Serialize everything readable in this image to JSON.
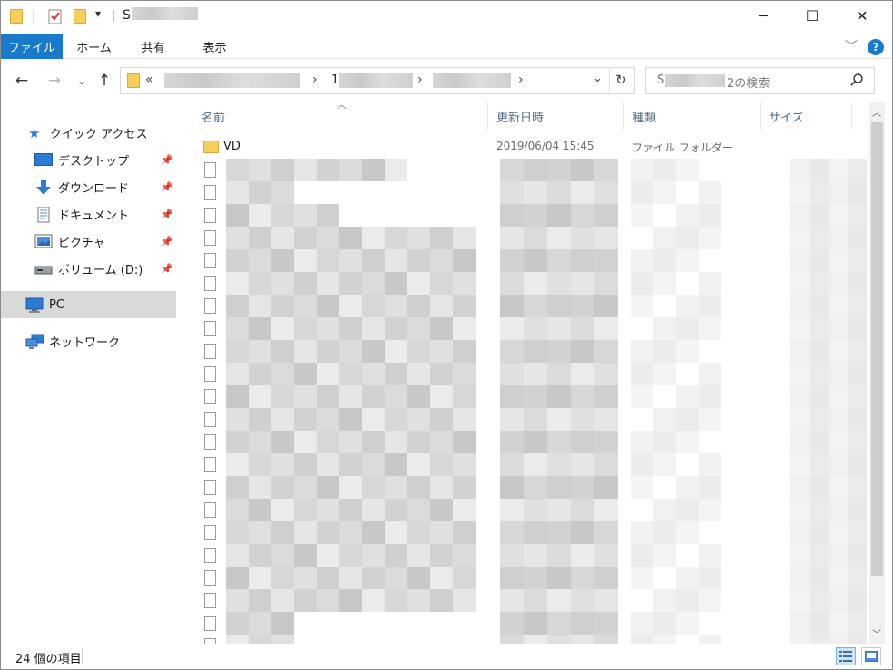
{
  "titlebar": {
    "title": "S",
    "minimize": "─",
    "maximize": "☐",
    "close": "✕"
  },
  "ribbon": {
    "tabs": [
      "ファイル",
      "ホーム",
      "共有",
      "表示"
    ],
    "expand_chevron": "﹀",
    "help": "?"
  },
  "nav": {
    "back": "←",
    "forward": "→",
    "recent": "⌄",
    "up": "↑"
  },
  "address": {
    "prefix": "«",
    "seg2": "1",
    "sep": "›",
    "dropdown": "⌄",
    "refresh": "↻"
  },
  "search": {
    "placeholder_prefix": "S",
    "placeholder_suffix": "2の検索",
    "icon": "search-icon"
  },
  "sidebar": {
    "items": [
      {
        "label": "クイック アクセス",
        "icon": "star-icon"
      },
      {
        "label": "デスクトップ",
        "icon": "desktop-icon",
        "pinned": true
      },
      {
        "label": "ダウンロード",
        "icon": "download-icon",
        "pinned": true
      },
      {
        "label": "ドキュメント",
        "icon": "document-icon",
        "pinned": true
      },
      {
        "label": "ピクチャ",
        "icon": "picture-icon",
        "pinned": true
      },
      {
        "label": "ボリューム (D:)",
        "icon": "drive-icon",
        "pinned": true
      },
      {
        "label": "PC",
        "icon": "pc-icon",
        "selected": true
      },
      {
        "label": "ネットワーク",
        "icon": "network-icon"
      }
    ]
  },
  "columns": {
    "name": "名前",
    "date": "更新日時",
    "type": "種類",
    "size": "サイズ",
    "sort_indicator": "︿"
  },
  "files": [
    {
      "name": "VD",
      "date": "2019/06/04 15:45",
      "type": "ファイル フォルダー",
      "kind": "folder"
    }
  ],
  "status": {
    "item_count": "24 個の項目"
  }
}
